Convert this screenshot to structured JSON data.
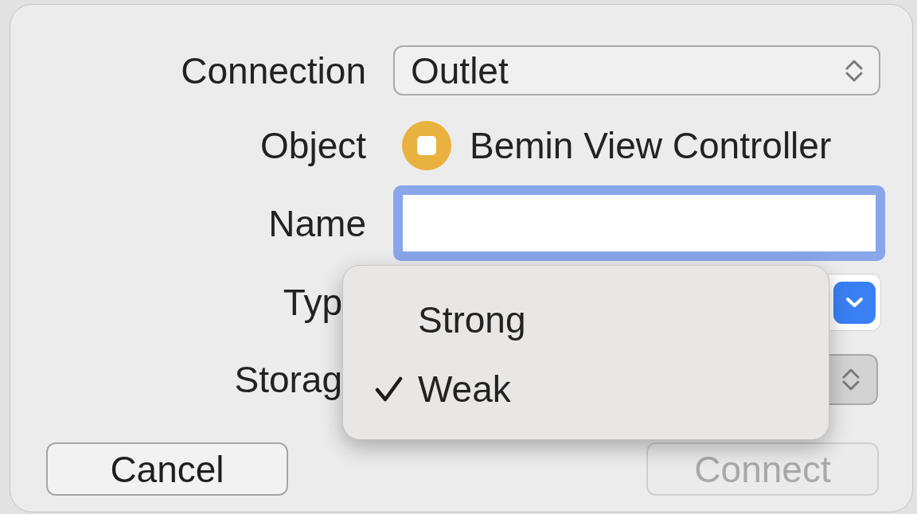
{
  "form": {
    "rows": [
      {
        "kind": "popup",
        "label": "Connection",
        "value": "Outlet",
        "pressed": false
      },
      {
        "kind": "object",
        "label": "Object",
        "value": "Bemin View Controller"
      },
      {
        "kind": "text_field",
        "label": "Name",
        "focused": true
      }
    ]
  },
  "covered_rows": [
    {
      "kind": "combo_box",
      "label": "Typ"
    },
    {
      "kind": "popup",
      "label": "Storag",
      "pressed": true
    }
  ],
  "menu": {
    "items": [
      {
        "label": "Strong",
        "selected": false
      },
      {
        "label": "Weak",
        "selected": true
      }
    ]
  },
  "buttons": [
    {
      "label": "Cancel",
      "disabled": false
    },
    {
      "label": "Connect",
      "disabled": true
    }
  ]
}
